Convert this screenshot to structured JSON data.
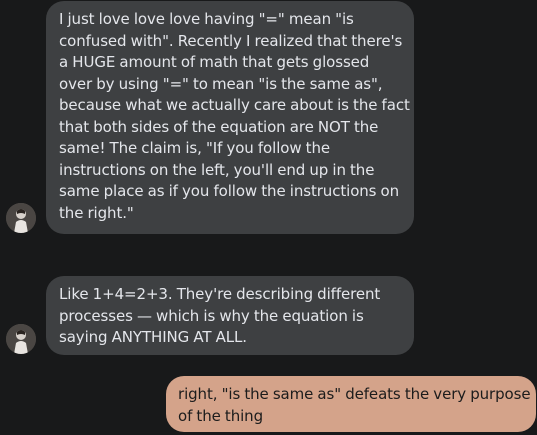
{
  "messages": [
    {
      "direction": "incoming",
      "lines": [
        "I just love love love having \"=\" mean \"is",
        "confused with\". Recently I realized that there's",
        "a HUGE amount of math that gets glossed",
        "over by using \"=\" to mean \"is the same as\",",
        "because what we actually care about is the fact",
        "that both sides of the equation are NOT the",
        "same! The claim is, \"If you follow the",
        "instructions on the left, you'll end up in the",
        "same place as if you follow the instructions on",
        "the right.\""
      ]
    },
    {
      "direction": "incoming",
      "lines": [
        "Like 1+4=2+3. They're describing different",
        "processes — which is why the equation is",
        "saying ANYTHING AT ALL."
      ]
    },
    {
      "direction": "outgoing",
      "lines": [
        "right, \"is the same as\" defeats the very purpose",
        "of the thing"
      ]
    }
  ],
  "avatars": [
    {
      "icon": "profile-photo"
    },
    {
      "icon": "profile-photo"
    }
  ],
  "colors": {
    "background": "#18191a",
    "incoming_bubble": "#3e4042",
    "incoming_text": "#e4e6eb",
    "outgoing_bubble": "#d4a38a",
    "outgoing_text": "#1c1c1c"
  }
}
